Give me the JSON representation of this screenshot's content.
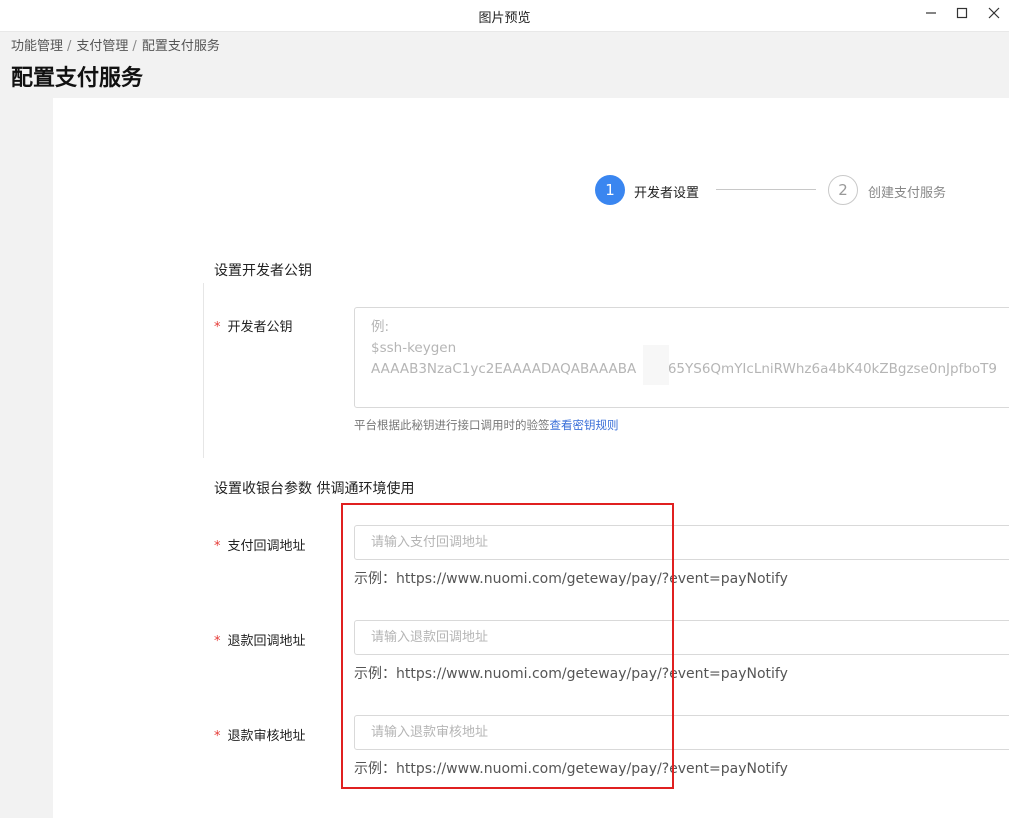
{
  "window": {
    "title": "图片预览",
    "minimize": "—",
    "close": "✕"
  },
  "breadcrumb": {
    "items": [
      "功能管理",
      "支付管理",
      "配置支付服务"
    ],
    "separator": "/"
  },
  "page": {
    "title": "配置支付服务"
  },
  "steps": [
    {
      "number": "1",
      "label": "开发者设置",
      "active": true
    },
    {
      "number": "2",
      "label": "创建支付服务",
      "active": false
    }
  ],
  "section_developer": {
    "title": "设置开发者公钥",
    "field_label": "开发者公钥",
    "required_mark": "*",
    "placeholder": "例:\n$ssh-keygen\nAAAAB3NzaC1yc2EAAAADAQABAAABA     H65YS6QmYIcLniRWhz6a4bK40kZBgzse0nJpfboT9",
    "hint_text": "平台根据此秘钥进行接口调用时的验签",
    "hint_link": "查看密钥规则"
  },
  "section_cashier": {
    "title": "设置收银台参数 供调通环境使用",
    "fields": [
      {
        "label": "支付回调地址",
        "placeholder": "请输入支付回调地址",
        "example": "示例：https://www.nuomi.com/geteway/pay/?event=payNotify"
      },
      {
        "label": "退款回调地址",
        "placeholder": "请输入退款回调地址",
        "example": "示例：https://www.nuomi.com/geteway/pay/?event=payNotify"
      },
      {
        "label": "退款审核地址",
        "placeholder": "请输入退款审核地址",
        "example": "示例：https://www.nuomi.com/geteway/pay/?event=payNotify"
      }
    ]
  },
  "colors": {
    "accent": "#3a86f0",
    "required": "#e53935",
    "highlight_box": "#e02020",
    "link": "#3a6fd8"
  }
}
